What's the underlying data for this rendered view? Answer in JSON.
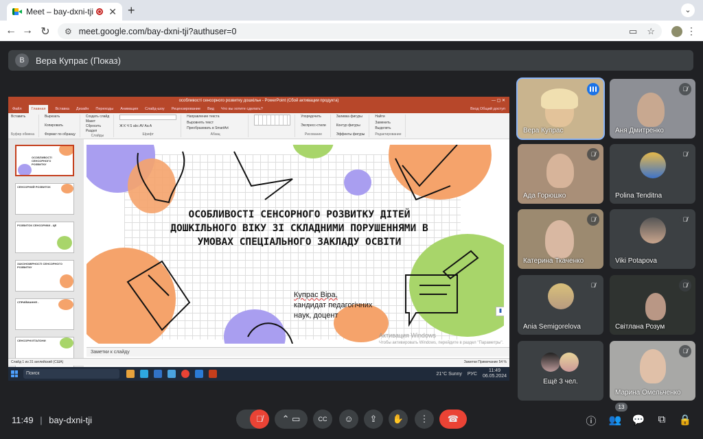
{
  "browser": {
    "tab_title": "Meet – bay-dxni-tji",
    "new_tab": "+",
    "url": "meet.google.com/bay-dxni-tji?authuser=0"
  },
  "presenter": {
    "avatar_letter": "В",
    "label": "Вера Купрас (Показ)"
  },
  "powerpoint": {
    "window_title": "особливості сенсорного розвитку дошкільн - PowerPoint (Сбой активации продукта)",
    "menu": [
      "Файл",
      "Главная",
      "Вставка",
      "Дизайн",
      "Переходы",
      "Анимация",
      "Слайд-шоу",
      "Рецензирование",
      "Вид",
      "Что вы хотите сделать?"
    ],
    "menu_right": "Вход  Общий доступ",
    "ribbon_groups": [
      {
        "items": [
          "Вставить"
        ],
        "label": "Буфер обмена"
      },
      {
        "items": [
          "Вырезать",
          "Копировать",
          "Формат по образцу"
        ],
        "label": ""
      },
      {
        "items": [
          "Создать слайд",
          "Макет",
          "Сбросить",
          "Раздел"
        ],
        "label": "Слайды"
      },
      {
        "items": [
          "Ж К Ч S abc AV Aa A"
        ],
        "label": "Шрифт"
      },
      {
        "items": [
          "Направление текста",
          "Выровнять текст",
          "Преобразовать в SmartArt"
        ],
        "label": "Абзац"
      },
      {
        "items": [
          "Упорядочить",
          "Экспресс-стили"
        ],
        "label": "Рисование"
      },
      {
        "items": [
          "Заливка фигуры",
          "Контур фигуры",
          "Эффекты фигуры"
        ],
        "label": ""
      },
      {
        "items": [
          "Найти",
          "Заменить",
          "Выделить"
        ],
        "label": "Редактирование"
      }
    ],
    "slide_title": "ОСОБЛИВОСТІ СЕНСОРНОГО РОЗВИТКУ ДІТЕЙ ДОШКІЛЬНОГО ВІКУ ЗІ СКЛАДНИМИ ПОРУШЕННЯМИ В УМОВАХ СПЕЦІАЛЬНОГО ЗАКЛАДУ ОСВІТИ",
    "author_name": "Купрас Віра,",
    "author_line2": "кандидат педагогічних",
    "author_line3": "наук, доцент",
    "activation_title": "Активация Windows",
    "activation_sub": "Чтобы активировать Windows, перейдите в раздел \"Параметры\".",
    "notes_placeholder": "Заметки к слайду",
    "status_left": "Слайд 1 из 31    английский (США)",
    "status_right": "Заметки   Примечание     54 %",
    "thumbnails": [
      {
        "num": "1",
        "text": "ОСОБЛИВОСТІ СЕНСОРНОГО РОЗВИТКУ"
      },
      {
        "num": "2",
        "text": "СЕНСОРНИЙ РОЗВИТОК"
      },
      {
        "num": "3",
        "text": "РОЗВИТОК СЕНСОРИКИ - ЦЕ"
      },
      {
        "num": "4",
        "text": "ЗАКОНОМІРНОСТІ СЕНСОРНОГО РОЗВИТКУ"
      },
      {
        "num": "5",
        "text": "СПРИЙМАННЯ -"
      },
      {
        "num": "6",
        "text": "СЕНСОРНІ ЕТАЛОНИ"
      }
    ]
  },
  "taskbar": {
    "search": "Поиск",
    "weather": "21°C  Sunny",
    "lang": "РУС",
    "time": "11:49",
    "date": "06.05.2024"
  },
  "participants": [
    {
      "name": "Вера Купрас",
      "state": "speaking",
      "bg": "#c9b48e"
    },
    {
      "name": "Аня Дмитренко",
      "state": "muted",
      "bg": "#8d8f95"
    },
    {
      "name": "Ада Горюшко",
      "state": "muted",
      "bg": "#a98f78"
    },
    {
      "name": "Polina Tenditna",
      "state": "muted",
      "avatar": true
    },
    {
      "name": "Катерина Ткаченко",
      "state": "muted",
      "bg": "#9c8a70"
    },
    {
      "name": "Viki Potapova",
      "state": "muted",
      "avatar": true
    },
    {
      "name": "Ania Semigorelova",
      "state": "muted",
      "avatar": true
    },
    {
      "name": "Світлана Розум",
      "state": "muted",
      "bg": "#2f3330"
    },
    {
      "name": "Ещё 3 чел.",
      "state": "muted",
      "avatar": true
    },
    {
      "name": "Марина Омельченко",
      "state": "muted",
      "bg": "#a8a8a6"
    }
  ],
  "bottom_bar": {
    "time": "11:49",
    "separator": "|",
    "meeting_code": "bay-dxni-tji",
    "participants_count": "13"
  },
  "colors": {
    "accent": "#8ab4f8",
    "end_call": "#ea4335",
    "ppt_red": "#b7472a",
    "blob_orange": "#f5a36b",
    "blob_purple": "#a99ef0",
    "blob_green": "#a8d56a"
  }
}
